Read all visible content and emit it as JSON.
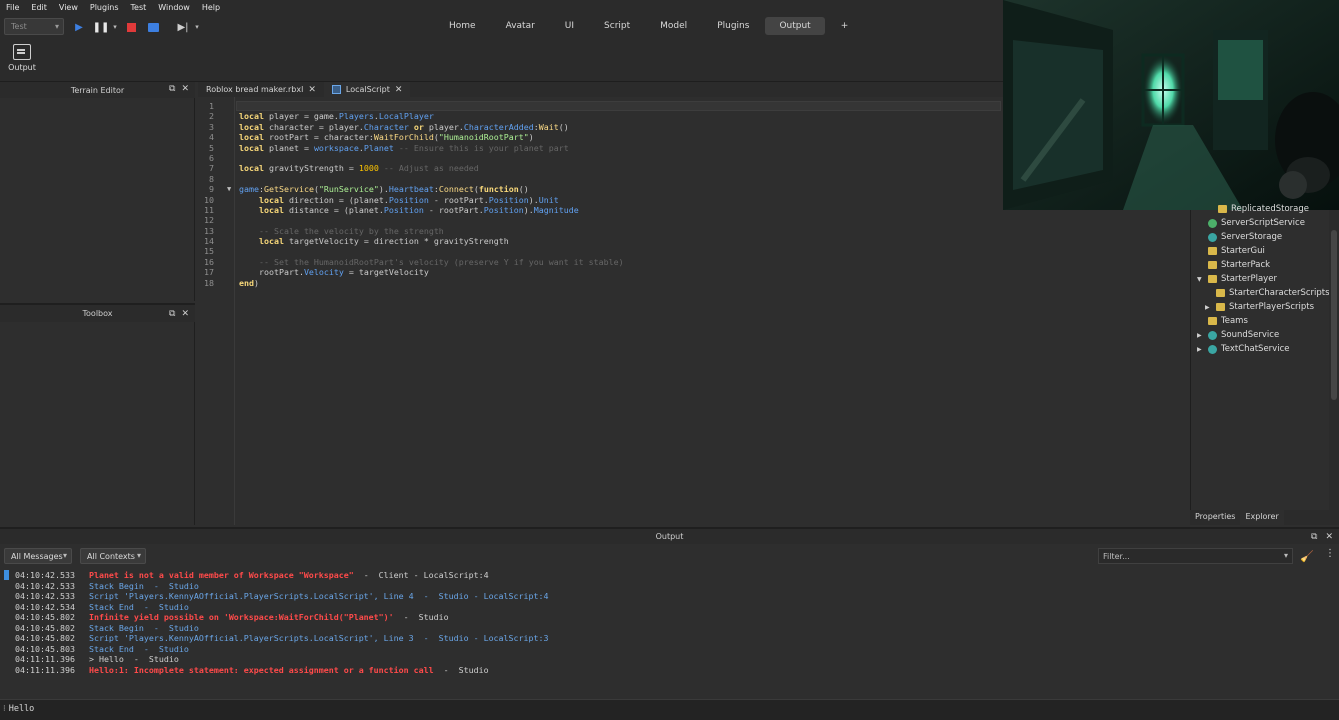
{
  "menu": [
    "File",
    "Edit",
    "View",
    "Plugins",
    "Test",
    "Window",
    "Help"
  ],
  "toolbar": {
    "mode_value": "Test",
    "tabs": [
      "Home",
      "Avatar",
      "UI",
      "Script",
      "Model",
      "Plugins",
      "Output",
      "+"
    ],
    "active_tab": "Output"
  },
  "ribbon": {
    "output_label": "Output"
  },
  "panels": {
    "terrain_editor": "Terrain Editor",
    "toolbox": "Toolbox"
  },
  "doc_tabs": [
    {
      "label": "Roblox bread maker.rbxl"
    },
    {
      "label": "LocalScript"
    }
  ],
  "code": {
    "line_numbers": [
      "1",
      "2",
      "3",
      "4",
      "5",
      "6",
      "7",
      "8",
      "9",
      "10",
      "11",
      "12",
      "13",
      "14",
      "15",
      "16",
      "17",
      "18"
    ],
    "lines": [
      "",
      "local player = game.Players.LocalPlayer",
      "local character = player.Character or player.CharacterAdded:Wait()",
      "local rootPart = character:WaitForChild(\"HumanoidRootPart\")",
      "local planet = workspace.Planet -- Ensure this is your planet part",
      "",
      "local gravityStrength = 1000 -- Adjust as needed",
      "",
      "game:GetService(\"RunService\").Heartbeat:Connect(function()",
      "    local direction = (planet.Position - rootPart.Position).Unit",
      "    local distance = (planet.Position - rootPart.Position).Magnitude",
      "",
      "    -- Scale the velocity by the strength",
      "    local targetVelocity = direction * gravityStrength",
      "",
      "    -- Set the HumanoidRootPart's velocity (preserve Y if you want it stable)",
      "    rootPart.Velocity = targetVelocity",
      "end)"
    ]
  },
  "explorer": {
    "items": [
      {
        "label": "ReplicatedStorage",
        "icon": "folder"
      },
      {
        "label": "ServerScriptService",
        "icon": "green"
      },
      {
        "label": "ServerStorage",
        "icon": "teal"
      },
      {
        "label": "StarterGui",
        "icon": "folder"
      },
      {
        "label": "StarterPack",
        "icon": "folder"
      },
      {
        "label": "StarterPlayer",
        "icon": "folder"
      },
      {
        "label": "StarterCharacterScripts",
        "icon": "folder"
      },
      {
        "label": "StarterPlayerScripts",
        "icon": "folder"
      },
      {
        "label": "Teams",
        "icon": "folder"
      },
      {
        "label": "SoundService",
        "icon": "teal"
      },
      {
        "label": "TextChatService",
        "icon": "teal"
      }
    ],
    "tabs": [
      "Properties",
      "Explorer"
    ]
  },
  "output": {
    "title": "Output",
    "filter_messages": "All Messages",
    "filter_contexts": "All Contexts",
    "filter_placeholder": "Filter...",
    "lines": [
      {
        "ts": "04:10:42.533",
        "msg": "Planet is not a valid member of Workspace \"Workspace\"",
        "tail": "  -  Client - LocalScript:4",
        "kind": "err"
      },
      {
        "ts": "04:10:42.533",
        "msg": "Stack Begin  -  Studio",
        "tail": "",
        "kind": "info"
      },
      {
        "ts": "04:10:42.533",
        "msg": "Script 'Players.KennyAOfficial.PlayerScripts.LocalScript', Line 4  -  Studio - LocalScript:4",
        "tail": "",
        "kind": "info"
      },
      {
        "ts": "04:10:42.534",
        "msg": "Stack End  -  Studio",
        "tail": "",
        "kind": "info"
      },
      {
        "ts": "04:10:45.802",
        "msg": "Infinite yield possible on 'Workspace:WaitForChild(\"Planet\")'",
        "tail": "  -  Studio",
        "kind": "err"
      },
      {
        "ts": "04:10:45.802",
        "msg": "Stack Begin  -  Studio",
        "tail": "",
        "kind": "info"
      },
      {
        "ts": "04:10:45.802",
        "msg": "Script 'Players.KennyAOfficial.PlayerScripts.LocalScript', Line 3  -  Studio - LocalScript:3",
        "tail": "",
        "kind": "info"
      },
      {
        "ts": "04:10:45.803",
        "msg": "Stack End  -  Studio",
        "tail": "",
        "kind": "info"
      },
      {
        "ts": "04:11:11.396",
        "msg": "> Hello  -  Studio",
        "tail": "",
        "kind": "plain"
      },
      {
        "ts": "04:11:11.396",
        "msg": "Hello:1: Incomplete statement: expected assignment or a function call",
        "tail": "  -  Studio",
        "kind": "err"
      }
    ]
  },
  "command_bar": {
    "value": "Hello"
  }
}
